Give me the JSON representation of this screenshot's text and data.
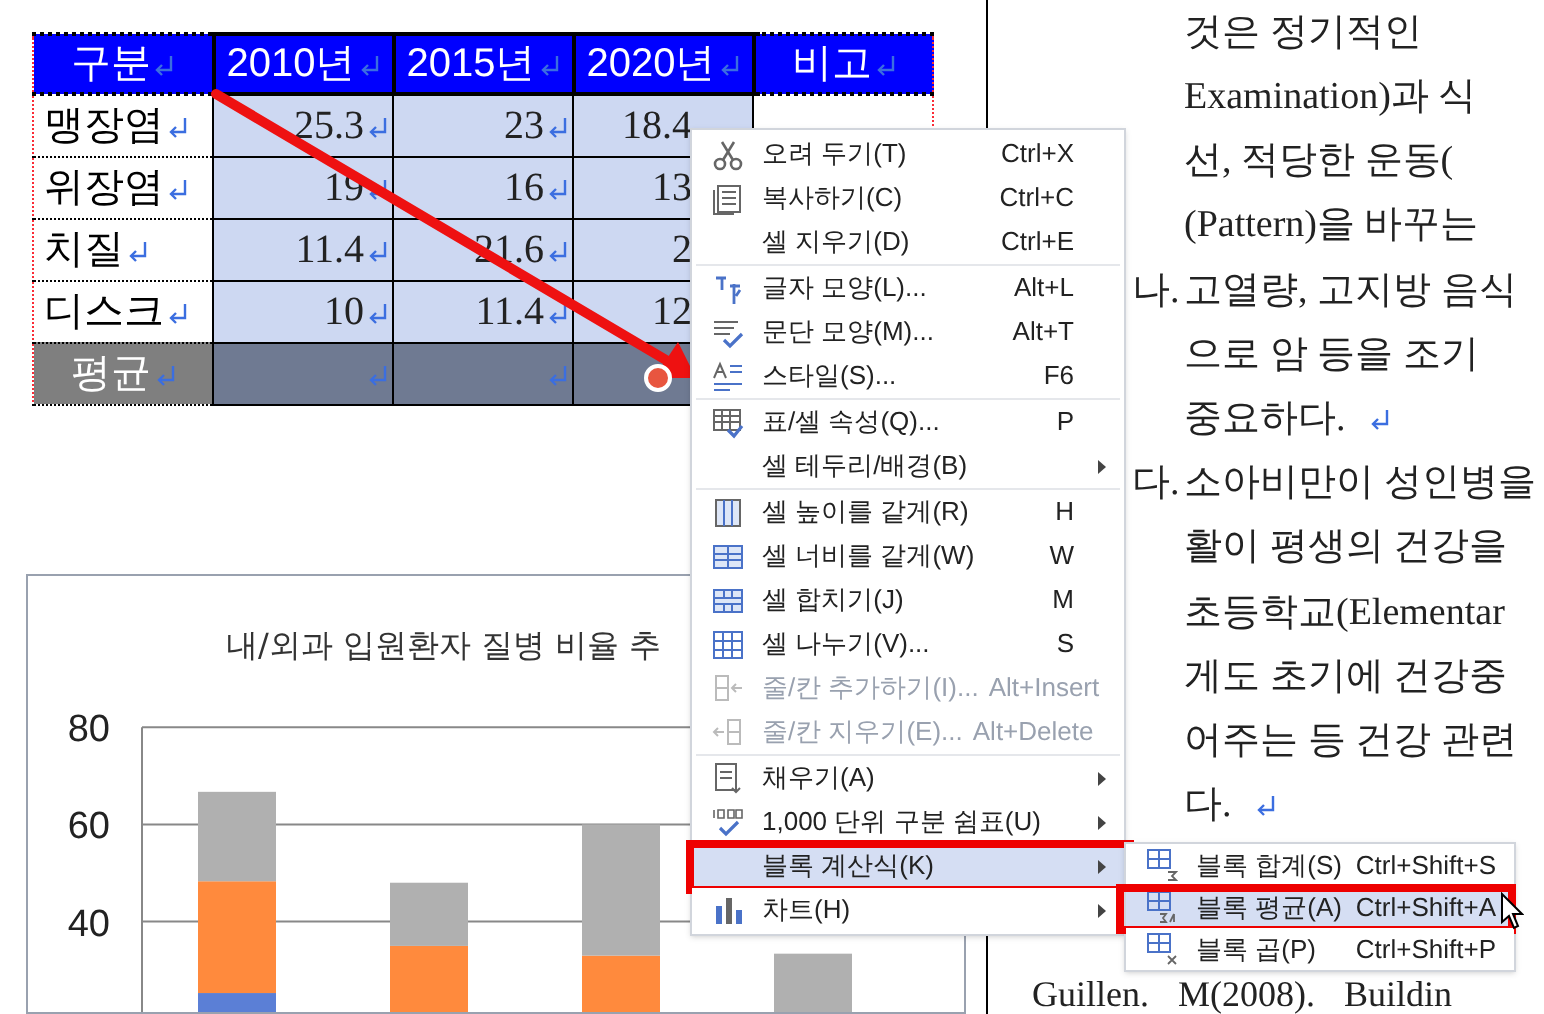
{
  "document": {
    "table": {
      "columns": [
        "구분",
        "2010년",
        "2015년",
        "2020년",
        "비고"
      ],
      "rows": [
        {
          "kind": "data",
          "label": "맹장염",
          "values": [
            "25.3",
            "23",
            "18.4"
          ],
          "selected": true
        },
        {
          "kind": "data",
          "label": "위장염",
          "values": [
            "19",
            "16",
            "13"
          ],
          "selected": true
        },
        {
          "kind": "data",
          "label": "치질",
          "values": [
            "11.4",
            "21.6",
            "2"
          ],
          "selected": true
        },
        {
          "kind": "data",
          "label": "디스크",
          "values": [
            "10",
            "11.4",
            "12"
          ],
          "selected": true
        },
        {
          "kind": "summary",
          "label": "평균",
          "selected": true
        }
      ]
    },
    "chart": {
      "title": "내/외과 입원환자 질병 비율 추",
      "y_tick_labels": [
        "80",
        "60",
        "40"
      ]
    },
    "text_lines": [
      {
        "text": "것은 정기적인",
        "paragraph_end": false
      },
      {
        "text": "Examination)과 식",
        "paragraph_end": false
      },
      {
        "text": "선, 적당한 운동(",
        "paragraph_end": false
      },
      {
        "text": "(Pattern)을 바꾸는",
        "paragraph_end": false
      },
      {
        "marker": "나.",
        "text": "고열량, 고지방 음식",
        "paragraph_end": false
      },
      {
        "text": "으로 암 등을 조기",
        "paragraph_end": false
      },
      {
        "text": "중요하다.",
        "paragraph_end": true
      },
      {
        "marker": "다.",
        "text": "소아비만이 성인병을",
        "paragraph_end": false
      },
      {
        "text": "활이 평생의 건강을",
        "paragraph_end": false
      },
      {
        "text": "초등학교(Elementar",
        "paragraph_end": false
      },
      {
        "text": "게도 초기에 건강중",
        "paragraph_end": false
      },
      {
        "text": "어주는 등 건강 관련",
        "paragraph_end": false
      },
      {
        "text": "다.",
        "paragraph_end": true
      }
    ],
    "reference": "Guillen. M(2008). Buildin"
  },
  "context_menu": {
    "groups": [
      [
        {
          "label": "오려 두기(T)",
          "shortcut": "Ctrl+X",
          "kind": "scissors",
          "disabled": false,
          "submenu": false,
          "selected": false,
          "outlined": false
        },
        {
          "label": "복사하기(C)",
          "shortcut": "Ctrl+C",
          "kind": "copy",
          "disabled": false,
          "submenu": false,
          "selected": false,
          "outlined": false
        },
        {
          "label": "셀 지우기(D)",
          "shortcut": "Ctrl+E",
          "kind": "plain",
          "disabled": false,
          "submenu": false,
          "selected": false,
          "outlined": false
        }
      ],
      [
        {
          "label": "글자 모양(L)...",
          "shortcut": "Alt+L",
          "kind": "font",
          "disabled": false,
          "submenu": false,
          "selected": false,
          "outlined": false
        },
        {
          "label": "문단 모양(M)...",
          "shortcut": "Alt+T",
          "kind": "paragraph",
          "disabled": false,
          "submenu": false,
          "selected": false,
          "outlined": false
        },
        {
          "label": "스타일(S)...",
          "shortcut": "F6",
          "kind": "style",
          "disabled": false,
          "submenu": false,
          "selected": false,
          "outlined": false
        }
      ],
      [
        {
          "label": "표/셀 속성(Q)...",
          "shortcut": "P",
          "kind": "table",
          "disabled": false,
          "submenu": false,
          "selected": false,
          "outlined": false
        },
        {
          "label": "셀 테두리/배경(B)",
          "kind": "plain",
          "disabled": false,
          "submenu": true,
          "selected": false,
          "outlined": false
        }
      ],
      [
        {
          "label": "셀 높이를 같게(R)",
          "shortcut": "H",
          "kind": "height",
          "disabled": false,
          "submenu": false,
          "selected": false,
          "outlined": false
        },
        {
          "label": "셀 너비를 같게(W)",
          "shortcut": "W",
          "kind": "width",
          "disabled": false,
          "submenu": false,
          "selected": false,
          "outlined": false
        },
        {
          "label": "셀 합치기(J)",
          "shortcut": "M",
          "kind": "merge",
          "disabled": false,
          "submenu": false,
          "selected": false,
          "outlined": false
        },
        {
          "label": "셀 나누기(V)...",
          "shortcut": "S",
          "kind": "split",
          "disabled": false,
          "submenu": false,
          "selected": false,
          "outlined": false
        },
        {
          "label": "줄/칸 추가하기(I)...",
          "shortcut": "Alt+Insert",
          "kind": "insert",
          "disabled": true,
          "submenu": false,
          "selected": false,
          "outlined": false
        },
        {
          "label": "줄/칸 지우기(E)...",
          "shortcut": "Alt+Delete",
          "kind": "remove",
          "disabled": true,
          "submenu": false,
          "selected": false,
          "outlined": false
        }
      ],
      [
        {
          "label": "채우기(A)",
          "kind": "fill",
          "disabled": false,
          "submenu": true,
          "selected": false,
          "outlined": false
        },
        {
          "label": "1,000 단위 구분 쉼표(U)",
          "kind": "comma",
          "disabled": false,
          "submenu": true,
          "selected": false,
          "outlined": false
        },
        {
          "label": "블록 계산식(K)",
          "kind": "plain",
          "disabled": false,
          "submenu": true,
          "selected": true,
          "outlined": true
        },
        {
          "label": "차트(H)",
          "kind": "chart",
          "disabled": false,
          "submenu": true,
          "selected": false,
          "outlined": false
        }
      ]
    ]
  },
  "submenu": {
    "items": [
      {
        "label": "블록 합계(S)",
        "shortcut": "Ctrl+Shift+S",
        "kind": "sum",
        "selected": false,
        "outlined": false
      },
      {
        "label": "블록 평균(A)",
        "shortcut": "Ctrl+Shift+A",
        "kind": "average",
        "selected": true,
        "outlined": true
      },
      {
        "label": "블록 곱(P)",
        "shortcut": "Ctrl+Shift+P",
        "kind": "product",
        "selected": false,
        "outlined": false
      }
    ]
  }
}
